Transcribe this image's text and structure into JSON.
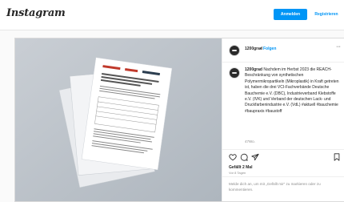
{
  "header": {
    "logo": "Instagram",
    "login_label": "Anmelden",
    "signup_label": "Registrieren"
  },
  "post": {
    "media_alt": "Dokument mit Veröffentlichung zur REACH-Beschränkung",
    "username": "1200grad",
    "separator": "•",
    "follow_label": "Folgen",
    "more_label": "···",
    "caption_user": "1200grad",
    "caption_text": " Nachdem im Herbst 2023 die REACH-Beschränkung von synthetischen Polymermikropartikeln (Mikroplastik) in Kraft getreten ist, haben die drei VCI-Fachverbände Deutsche Bauchemie e.V. (DBC), Industrieverband Klebstoffe e.V. (IVK) und Verband der deutschen Lack- und Druckfarbenindustrie e.V. (VdL) #aktuell #bauchemie #baupraxis #baustoff",
    "caption_ago": "47Wo.",
    "likes": "Gefällt 2 Mal",
    "date": "Vor 8 Tagen",
    "login_prompt_pre": "Melde dich an, um mit „Gefällt mir“ zu markieren oder zu kommentieren.",
    "login_prompt_link": "Melde dich an"
  },
  "icons": [
    "heart-icon",
    "comment-icon",
    "share-icon",
    "bookmark-icon",
    "more-icon"
  ],
  "colors": {
    "accent": "#0095f6",
    "text": "#262626",
    "muted": "#8e8e8e",
    "border": "#dbdbdb"
  }
}
